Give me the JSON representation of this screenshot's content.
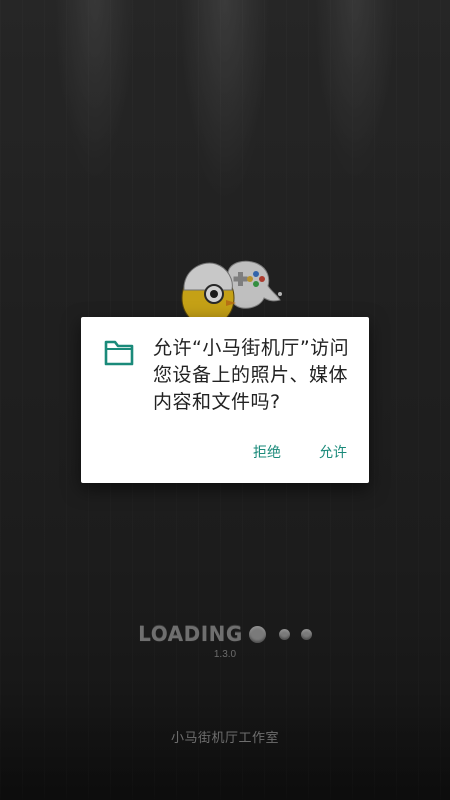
{
  "colors": {
    "accent": "#1a8a7a",
    "dialog_bg": "#ffffff",
    "text_primary": "#222222",
    "background": "#262626",
    "muted_text": "#6e6e6e"
  },
  "permission_dialog": {
    "icon": "folder-icon",
    "message": "允许“小马街机厅”访问您设备上的照片、媒体内容和文件吗?",
    "deny_label": "拒绝",
    "allow_label": "允许"
  },
  "splash": {
    "mascot_icon": "gamepad-mascot-icon",
    "loading_text": "LOADING",
    "version": "1.3.0",
    "studio": "小马街机厅工作室"
  }
}
